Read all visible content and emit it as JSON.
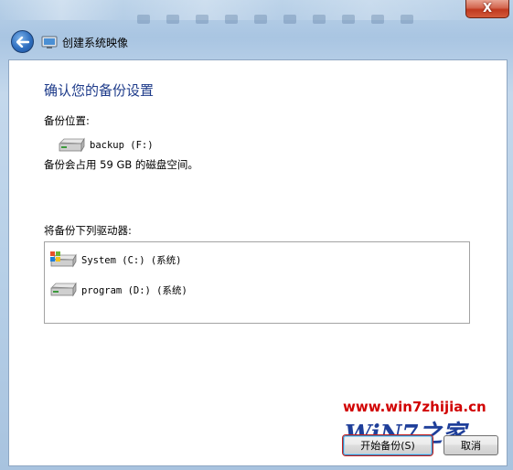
{
  "window": {
    "title": "创建系统映像",
    "close_label": "X"
  },
  "page": {
    "heading": "确认您的备份设置",
    "location_label": "备份位置:",
    "location_drive": "backup (F:)",
    "space_note": "备份会占用 59 GB 的磁盘空间。",
    "drives_label": "将备份下列驱动器:",
    "drives": [
      {
        "label": "System (C:) (系统)",
        "icon": "windows-drive-icon"
      },
      {
        "label": "program (D:) (系统)",
        "icon": "hard-drive-icon"
      }
    ]
  },
  "buttons": {
    "start": "开始备份(S)",
    "cancel": "取消"
  },
  "watermark": {
    "url": "www.win7zhijia.cn",
    "logo": "WiN7之家"
  },
  "colors": {
    "heading": "#1e3b8a",
    "watermark_red": "#d10000",
    "highlight_red": "#c62020"
  }
}
